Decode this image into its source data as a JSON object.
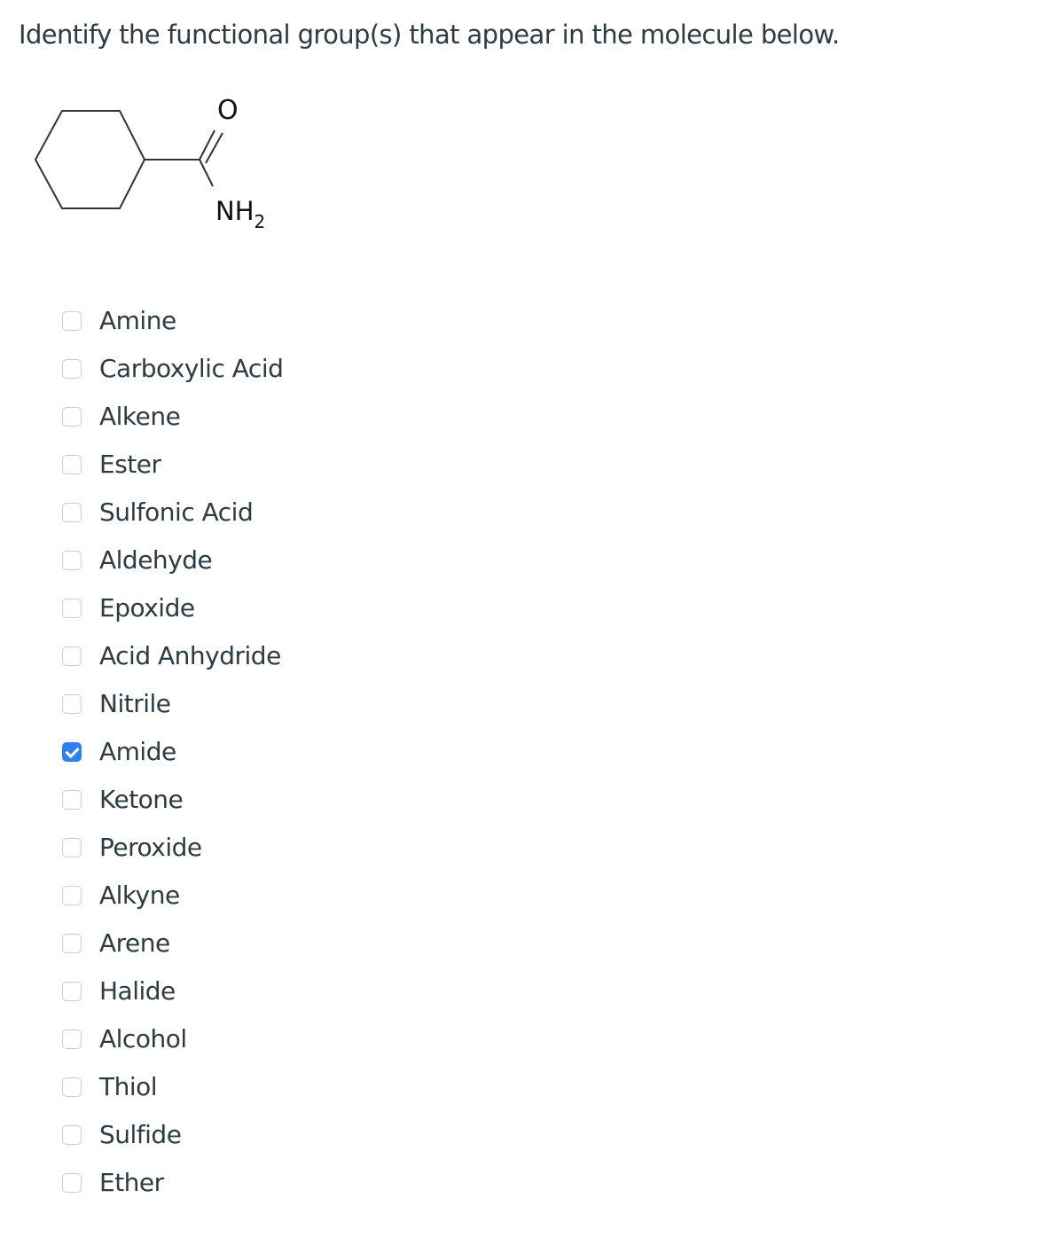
{
  "question": "Identify the functional group(s) that appear in the molecule below.",
  "molecule": {
    "name": "cyclohexanecarboxamide",
    "atom_labels": {
      "oxygen": "O",
      "amine": "NH",
      "subscript": "2"
    }
  },
  "options": [
    {
      "label": "Amine",
      "checked": false
    },
    {
      "label": "Carboxylic Acid",
      "checked": false
    },
    {
      "label": "Alkene",
      "checked": false
    },
    {
      "label": "Ester",
      "checked": false
    },
    {
      "label": "Sulfonic Acid",
      "checked": false
    },
    {
      "label": "Aldehyde",
      "checked": false
    },
    {
      "label": "Epoxide",
      "checked": false
    },
    {
      "label": "Acid Anhydride",
      "checked": false
    },
    {
      "label": "Nitrile",
      "checked": false
    },
    {
      "label": "Amide",
      "checked": true
    },
    {
      "label": "Ketone",
      "checked": false
    },
    {
      "label": "Peroxide",
      "checked": false
    },
    {
      "label": "Alkyne",
      "checked": false
    },
    {
      "label": "Arene",
      "checked": false
    },
    {
      "label": "Halide",
      "checked": false
    },
    {
      "label": "Alcohol",
      "checked": false
    },
    {
      "label": "Thiol",
      "checked": false
    },
    {
      "label": "Sulfide",
      "checked": false
    },
    {
      "label": "Ether",
      "checked": false
    }
  ],
  "colors": {
    "text": "#2d3b45",
    "checkbox_checked": "#2f80ed",
    "checkbox_border": "#c7cdd1"
  }
}
